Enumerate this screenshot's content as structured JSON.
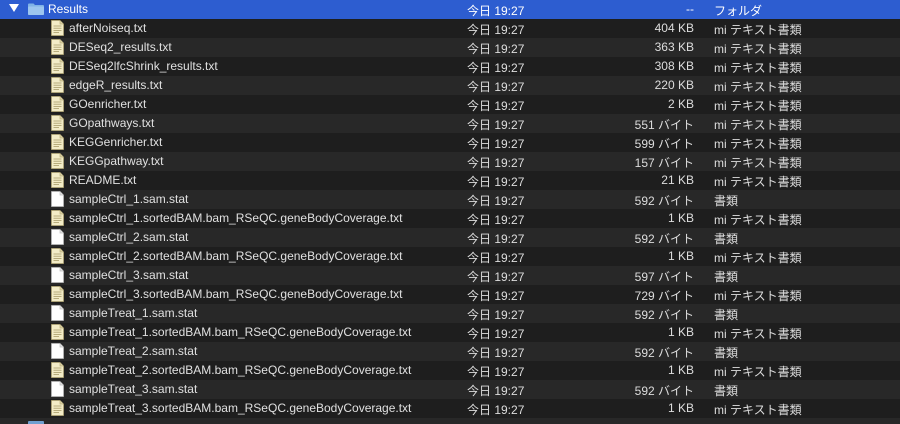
{
  "folder": {
    "name": "Results",
    "date": "今日 19:27",
    "size": "--",
    "kind": "フォルダ"
  },
  "files": [
    {
      "name": "afterNoiseq.txt",
      "date": "今日 19:27",
      "size": "404 KB",
      "kind": "mi テキスト書類",
      "icon": "text-document-icon"
    },
    {
      "name": "DESeq2_results.txt",
      "date": "今日 19:27",
      "size": "363 KB",
      "kind": "mi テキスト書類",
      "icon": "text-document-icon"
    },
    {
      "name": "DESeq2lfcShrink_results.txt",
      "date": "今日 19:27",
      "size": "308 KB",
      "kind": "mi テキスト書類",
      "icon": "text-document-icon"
    },
    {
      "name": "edgeR_results.txt",
      "date": "今日 19:27",
      "size": "220 KB",
      "kind": "mi テキスト書類",
      "icon": "text-document-icon"
    },
    {
      "name": "GOenricher.txt",
      "date": "今日 19:27",
      "size": "2 KB",
      "kind": "mi テキスト書類",
      "icon": "text-document-icon"
    },
    {
      "name": "GOpathways.txt",
      "date": "今日 19:27",
      "size": "551 バイト",
      "kind": "mi テキスト書類",
      "icon": "text-document-icon"
    },
    {
      "name": "KEGGenricher.txt",
      "date": "今日 19:27",
      "size": "599 バイト",
      "kind": "mi テキスト書類",
      "icon": "text-document-icon"
    },
    {
      "name": "KEGGpathway.txt",
      "date": "今日 19:27",
      "size": "157 バイト",
      "kind": "mi テキスト書類",
      "icon": "text-document-icon"
    },
    {
      "name": "README.txt",
      "date": "今日 19:27",
      "size": "21 KB",
      "kind": "mi テキスト書類",
      "icon": "text-document-icon"
    },
    {
      "name": "sampleCtrl_1.sam.stat",
      "date": "今日 19:27",
      "size": "592 バイト",
      "kind": "書類",
      "icon": "blank-document-icon"
    },
    {
      "name": "sampleCtrl_1.sortedBAM.bam_RSeQC.geneBodyCoverage.txt",
      "date": "今日 19:27",
      "size": "1 KB",
      "kind": "mi テキスト書類",
      "icon": "text-document-icon"
    },
    {
      "name": "sampleCtrl_2.sam.stat",
      "date": "今日 19:27",
      "size": "592 バイト",
      "kind": "書類",
      "icon": "blank-document-icon"
    },
    {
      "name": "sampleCtrl_2.sortedBAM.bam_RSeQC.geneBodyCoverage.txt",
      "date": "今日 19:27",
      "size": "1 KB",
      "kind": "mi テキスト書類",
      "icon": "text-document-icon"
    },
    {
      "name": "sampleCtrl_3.sam.stat",
      "date": "今日 19:27",
      "size": "597 バイト",
      "kind": "書類",
      "icon": "blank-document-icon"
    },
    {
      "name": "sampleCtrl_3.sortedBAM.bam_RSeQC.geneBodyCoverage.txt",
      "date": "今日 19:27",
      "size": "729 バイト",
      "kind": "mi テキスト書類",
      "icon": "text-document-icon"
    },
    {
      "name": "sampleTreat_1.sam.stat",
      "date": "今日 19:27",
      "size": "592 バイト",
      "kind": "書類",
      "icon": "blank-document-icon"
    },
    {
      "name": "sampleTreat_1.sortedBAM.bam_RSeQC.geneBodyCoverage.txt",
      "date": "今日 19:27",
      "size": "1 KB",
      "kind": "mi テキスト書類",
      "icon": "text-document-icon"
    },
    {
      "name": "sampleTreat_2.sam.stat",
      "date": "今日 19:27",
      "size": "592 バイト",
      "kind": "書類",
      "icon": "blank-document-icon"
    },
    {
      "name": "sampleTreat_2.sortedBAM.bam_RSeQC.geneBodyCoverage.txt",
      "date": "今日 19:27",
      "size": "1 KB",
      "kind": "mi テキスト書類",
      "icon": "text-document-icon"
    },
    {
      "name": "sampleTreat_3.sam.stat",
      "date": "今日 19:27",
      "size": "592 バイト",
      "kind": "書類",
      "icon": "blank-document-icon"
    },
    {
      "name": "sampleTreat_3.sortedBAM.bam_RSeQC.geneBodyCoverage.txt",
      "date": "今日 19:27",
      "size": "1 KB",
      "kind": "mi テキスト書類",
      "icon": "text-document-icon"
    }
  ],
  "colors": {
    "selection": "#2d5dd0",
    "background": "#1e1e1e",
    "alternate_row": "#282828",
    "folder": "#6fa8dc"
  }
}
